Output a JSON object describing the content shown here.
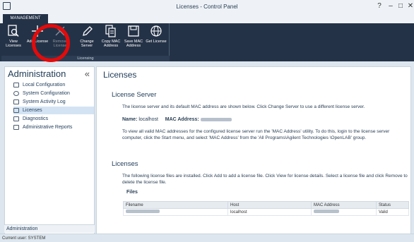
{
  "window": {
    "title": "Licenses - Control Panel",
    "help": "?",
    "minimize": "–",
    "maximize": "□",
    "close": "✕"
  },
  "ribbon": {
    "tab": "MANAGEMENT",
    "group_label": "Licensing",
    "buttons": [
      {
        "label": "View Licenses",
        "icon": "view-licenses-icon"
      },
      {
        "label": "Add License",
        "icon": "plus-icon"
      },
      {
        "label": "Remove License",
        "icon": "remove-icon"
      },
      {
        "label": "Change Server",
        "icon": "pencil-icon"
      },
      {
        "label": "Copy MAC Address",
        "icon": "copy-icon"
      },
      {
        "label": "Save MAC Address",
        "icon": "save-icon"
      },
      {
        "label": "Get License",
        "icon": "globe-icon"
      }
    ]
  },
  "sidebar": {
    "title": "Administration",
    "collapse": "«",
    "items": [
      {
        "label": "Local Configuration"
      },
      {
        "label": "System Configuration"
      },
      {
        "label": "System Activity Log"
      },
      {
        "label": "Licenses"
      },
      {
        "label": "Diagnostics"
      },
      {
        "label": "Administrative Reports"
      }
    ],
    "footer": "Administration"
  },
  "main": {
    "title": "Licenses",
    "server": {
      "heading": "License Server",
      "desc": "The license server and its default MAC address are shown below. Click Change Server to use a different license server.",
      "name_label": "Name:",
      "name_value": "localhost",
      "mac_label": "MAC Address:",
      "note": "To view all valid MAC addresses for the configured license server run the 'MAC Address' utility.  To do this, login to the license server computer, click the Start menu, and select 'MAC Address' from the 'All Programs\\Agilent Technologies \\OpenLAB' group."
    },
    "licenses": {
      "heading": "Licenses",
      "desc": "The following license files are installed. Click Add to add a license file. Click View for license details. Select a license file and click Remove to delete the license file.",
      "files_label": "Files",
      "columns": [
        "Filename",
        "Host",
        "MAC Address",
        "Status"
      ],
      "rows": [
        {
          "host": "localhost",
          "status": "Valid"
        }
      ]
    }
  },
  "status": "Current user: SYSTEM",
  "colors": {
    "ribbon": "#243247",
    "highlight": "#e50a0a",
    "active_row": "#d3e3f3"
  }
}
